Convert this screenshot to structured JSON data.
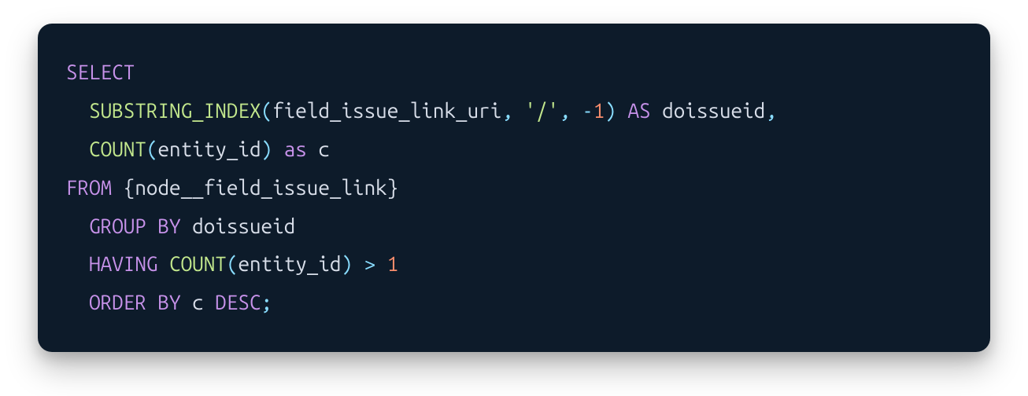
{
  "code": {
    "line1": {
      "kw_select": "SELECT"
    },
    "line2": {
      "func_substring_index": "SUBSTRING_INDEX",
      "paren_open": "(",
      "arg1": "field_issue_link_uri",
      "comma1": ",",
      "str_slash": "'/'",
      "comma2": ",",
      "neg_sign": "-",
      "neg_val": "1",
      "paren_close": ")",
      "kw_as": "AS",
      "alias1": "doissueid",
      "comma3": ","
    },
    "line3": {
      "func_count": "COUNT",
      "paren_open": "(",
      "arg": "entity_id",
      "paren_close": ")",
      "kw_as": "as",
      "alias": "c"
    },
    "line4": {
      "kw_from": "FROM",
      "table": "{node__field_issue_link}"
    },
    "line5": {
      "kw_group_by": "GROUP BY",
      "col": "doissueid"
    },
    "line6": {
      "kw_having": "HAVING",
      "func_count": "COUNT",
      "paren_open": "(",
      "arg": "entity_id",
      "paren_close": ")",
      "op_gt": ">",
      "val": "1"
    },
    "line7": {
      "kw_order_by": "ORDER BY",
      "col": "c",
      "kw_desc": "DESC",
      "semi": ";"
    }
  }
}
